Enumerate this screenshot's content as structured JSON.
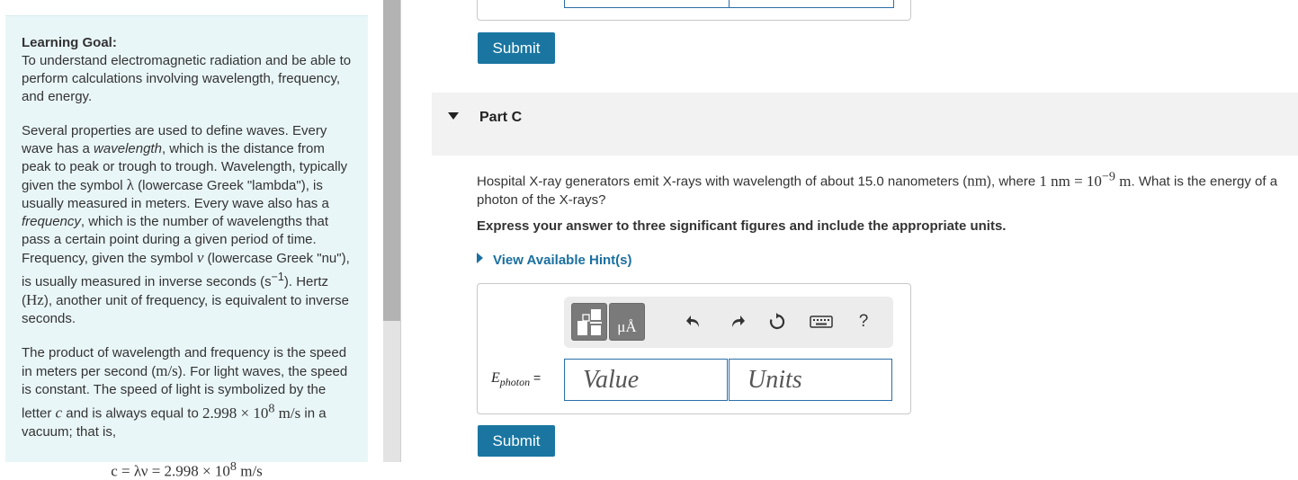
{
  "goal": {
    "title": "Learning Goal:",
    "intro": "To understand electromagnetic radiation and be able to perform calculations involving wavelength, frequency, and energy.",
    "p1": {
      "a": "Several properties are used to define waves. Every wave has a ",
      "wavelength": "wavelength",
      "b": ", which is the distance from peak to peak or trough to trough. Wavelength, typically given the symbol ",
      "lambda": "λ",
      "c": " (lowercase Greek \"lambda\"), is usually measured in meters. Every wave also has a ",
      "frequency": "frequency",
      "d": ", which is the number of wavelengths that pass a certain point during a given period of time. Frequency, given the symbol ",
      "nu": "ν",
      "e": " (lowercase Greek \"nu\"), is usually measured in inverse seconds (",
      "s": "s",
      "s_exp": "−1",
      "f": "). Hertz (",
      "hz": "Hz",
      "g": "), another unit of frequency, is equivalent to inverse seconds."
    },
    "p2": {
      "a": "The product of wavelength and frequency is the speed in meters per second (",
      "ms": "m/s",
      "b": "). For light waves, the speed is constant. The speed of light is symbolized by the letter ",
      "c": "c",
      "d": " and is always equal to ",
      "val": "2.998 × 10",
      "val_exp": "8",
      "val_unit": " m/s",
      "e": " in a vacuum; that is,"
    },
    "equation": {
      "lhs": "c = λν = 2.998 × 10",
      "exp": "8",
      "unit": " m/s"
    }
  },
  "submit_label": "Submit",
  "part": {
    "title": "Part C"
  },
  "question": {
    "a": "Hospital X-ray generators emit X-rays with wavelength of about 15.0 nanometers (",
    "nm": "nm",
    "b": "), where ",
    "eq": "1 nm = 10",
    "exp": "−9",
    "unit": " m",
    "c": ". What is the energy of a photon of the X-rays?"
  },
  "instruction": "Express your answer to three significant figures and include the appropriate units.",
  "hints_label": "View Available Hint(s)",
  "toolbar": {
    "units_button": "μÅ",
    "help": "?",
    "icons": [
      "templates-icon",
      "units-icon",
      "undo-icon",
      "redo-icon",
      "reset-icon",
      "keyboard-icon",
      "help-icon"
    ]
  },
  "answer": {
    "label_var": "E",
    "label_sub": "photon",
    "label_eq": " =",
    "value_placeholder": "Value",
    "units_placeholder": "Units"
  },
  "colors": {
    "accent": "#1a76a1",
    "panel": "#e9f6f8",
    "header": "#f2f2f2",
    "link": "#1a6fa0"
  }
}
